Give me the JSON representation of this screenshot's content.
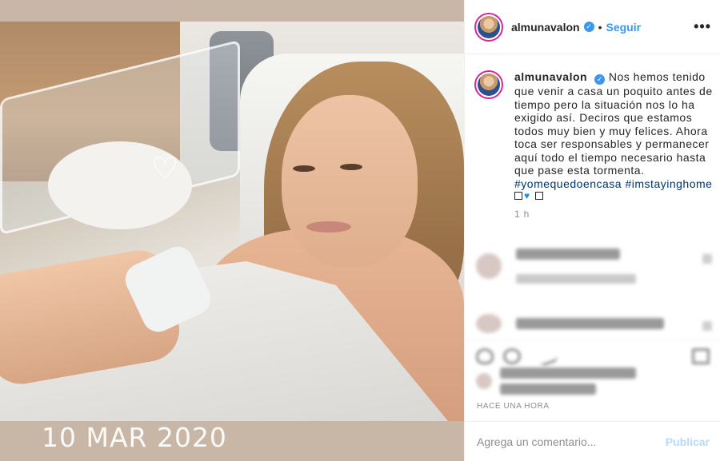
{
  "photo": {
    "date_stamp": "10 MAR 2020",
    "heart_glyph": "♡"
  },
  "post": {
    "username": "almunavalon",
    "verified_glyph": "✓",
    "separator": "•",
    "follow_label": "Seguir",
    "more_label": "•••"
  },
  "caption": {
    "username": "almunavalon",
    "text": "Nos hemos tenido que venir a casa un poquito antes de tiempo pero la situación nos lo ha exigido así. Deciros que estamos todos muy bien y muy felices. Ahora toca ser responsables y permanecer aquí todo el tiempo necesario hasta que pase esta tormenta.",
    "hashtag_1": "#yomequedoencasa",
    "hashtag_2": "#imstayinghome",
    "time": "1 h"
  },
  "footer": {
    "time_ago": "HACE UNA HORA",
    "comment_placeholder": "Agrega un comentario...",
    "publish_label": "Publicar"
  },
  "colors": {
    "link_blue": "#3897f0",
    "hashtag": "#003569",
    "publish_disabled": "#b3dbff",
    "story_ring": "#d6249f"
  },
  "icons": [
    "verified-badge-icon",
    "more-options-icon",
    "heart-icon",
    "comment-icon",
    "share-icon",
    "bookmark-icon"
  ]
}
